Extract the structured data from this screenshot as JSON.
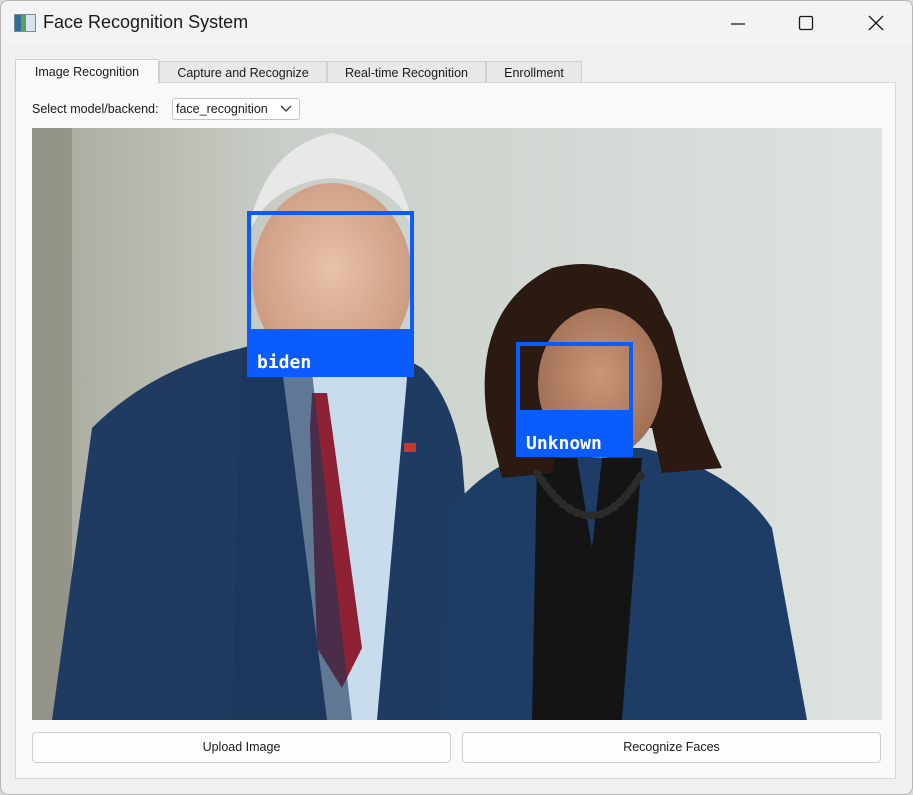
{
  "window": {
    "title": "Face Recognition System",
    "icon": "app-icon"
  },
  "controls": {
    "minimize": "minimize-icon",
    "maximize": "maximize-icon",
    "close": "close-icon"
  },
  "tabs": [
    {
      "label": "Image Recognition",
      "active": true
    },
    {
      "label": "Capture and Recognize",
      "active": false
    },
    {
      "label": "Real-time Recognition",
      "active": false
    },
    {
      "label": "Enrollment",
      "active": false
    }
  ],
  "model_select": {
    "label": "Select model/backend:",
    "value": "face_recognition"
  },
  "image": {
    "faces": [
      {
        "name": "biden",
        "box_color": "#0a5cff"
      },
      {
        "name": "Unknown",
        "box_color": "#0a5cff"
      }
    ]
  },
  "buttons": {
    "upload": "Upload Image",
    "recognize": "Recognize Faces"
  },
  "colors": {
    "accent": "#0a5cff",
    "window_bg": "#f0f0f0",
    "panel_bg": "#f9f9f9"
  }
}
